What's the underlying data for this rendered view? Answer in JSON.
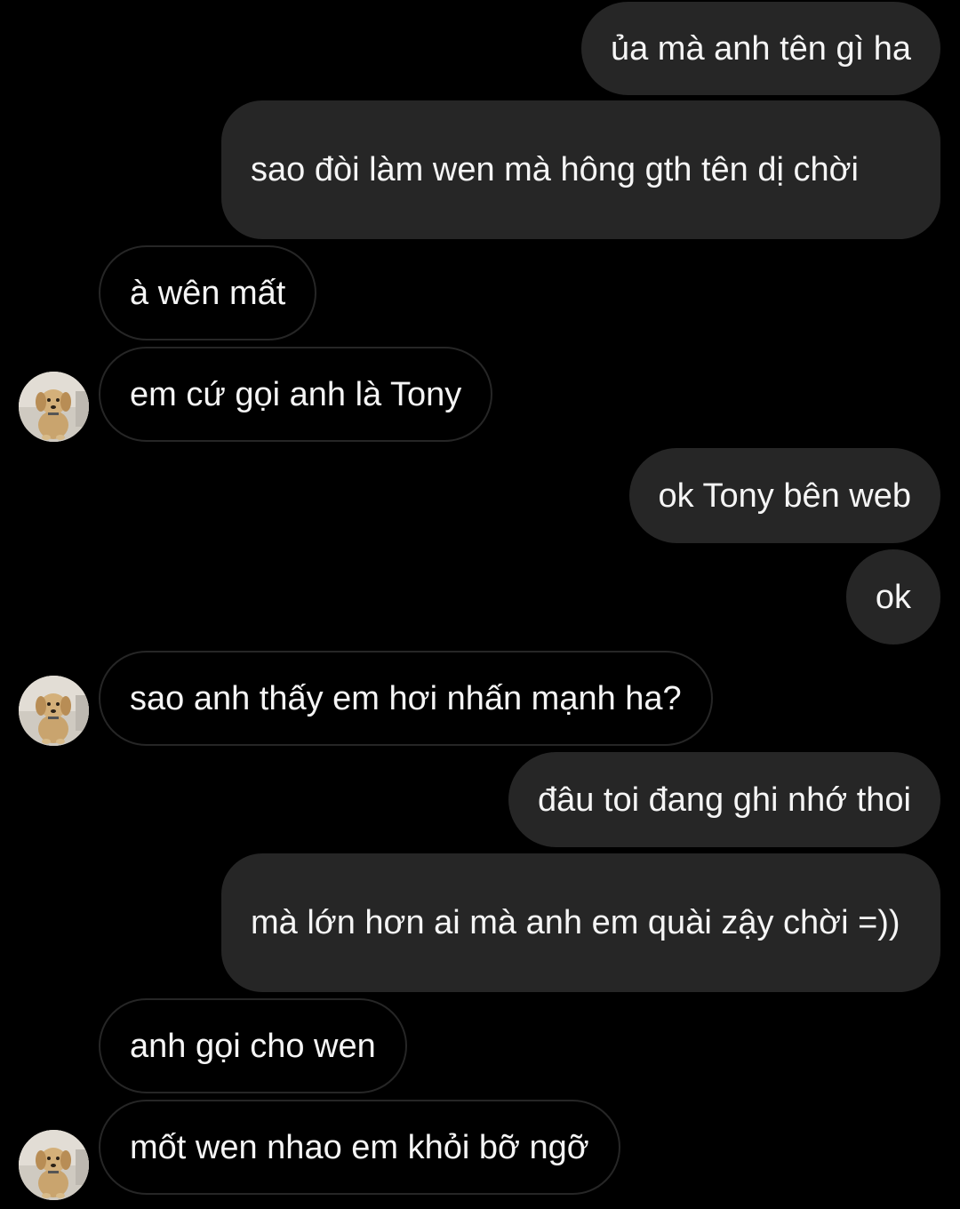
{
  "conversation": {
    "messages": [
      {
        "from": "me",
        "text": "ủa mà anh tên gì ha"
      },
      {
        "from": "me",
        "text": "sao đòi làm wen mà hông gth tên dị chời"
      },
      {
        "from": "them",
        "text": "à wên mất"
      },
      {
        "from": "them",
        "text": "em cứ gọi anh là Tony"
      },
      {
        "from": "me",
        "text": "ok Tony bên web"
      },
      {
        "from": "me",
        "text": "ok"
      },
      {
        "from": "them",
        "text": "sao anh thấy em hơi nhấn mạnh ha?"
      },
      {
        "from": "me",
        "text": "đâu toi đang ghi nhớ thoi"
      },
      {
        "from": "me",
        "text": "mà lớn hơn ai mà anh em quài zậy chời =))"
      },
      {
        "from": "them",
        "text": "anh gọi cho wen"
      },
      {
        "from": "them",
        "text": "mốt wen nhao em khỏi bỡ ngỡ"
      }
    ],
    "contact_avatar_icon": "puppy-avatar-icon",
    "colors": {
      "background": "#000000",
      "sent_bubble": "#262626",
      "received_border": "#262626",
      "text": "#f5f5f5"
    }
  }
}
